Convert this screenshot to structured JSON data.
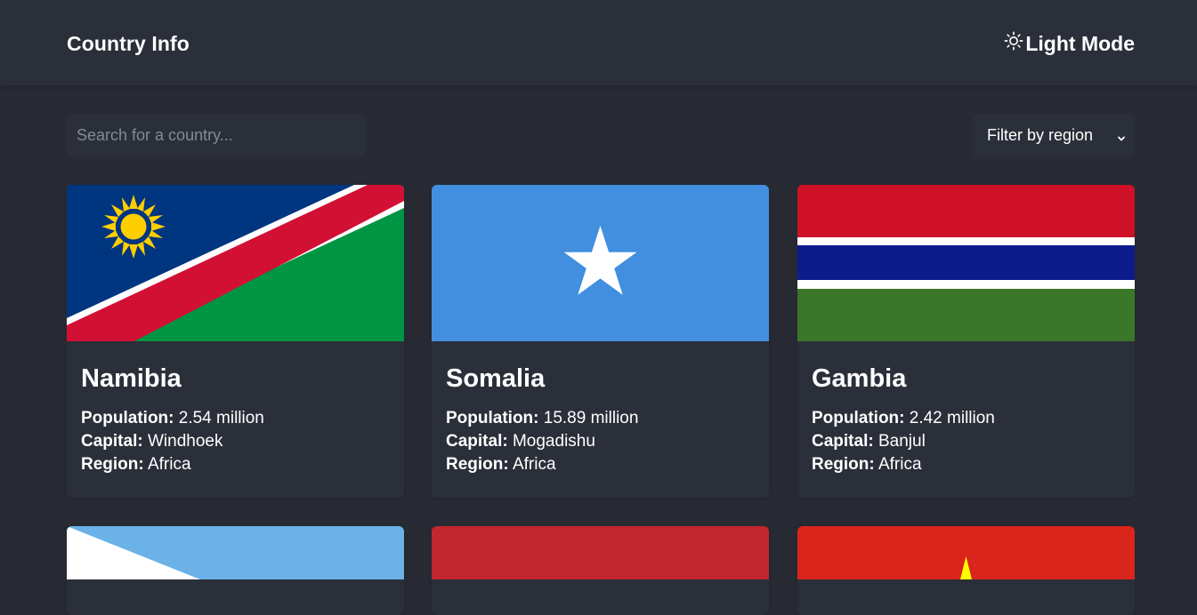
{
  "header": {
    "title": "Country Info",
    "theme_toggle_label": "Light Mode",
    "theme_toggle_icon": "sun-icon"
  },
  "controls": {
    "search_placeholder": "Search for a country...",
    "search_value": "",
    "filter_label": "Filter by region",
    "filter_icon": "chevron-down-icon"
  },
  "labels": {
    "population": "Population:",
    "capital": "Capital:",
    "region": "Region:"
  },
  "countries": [
    {
      "name": "Namibia",
      "population": "2.54 million",
      "capital": "Windhoek",
      "region": "Africa"
    },
    {
      "name": "Somalia",
      "population": "15.89 million",
      "capital": "Mogadishu",
      "region": "Africa"
    },
    {
      "name": "Gambia",
      "population": "2.42 million",
      "capital": "Banjul",
      "region": "Africa"
    }
  ],
  "colors": {
    "background": "#282b33",
    "surface": "#2b2f39",
    "text": "#ffffff"
  }
}
